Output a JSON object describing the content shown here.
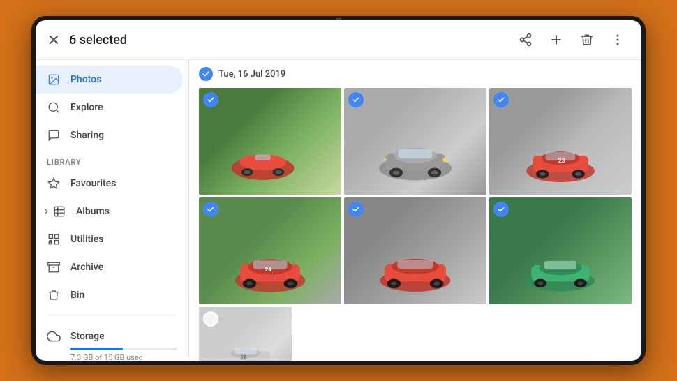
{
  "device": {
    "bg_color": "#D4711A"
  },
  "topbar": {
    "selected_count": "6 selected",
    "icons": {
      "close": "✕",
      "share": "share",
      "add": "+",
      "delete": "delete",
      "more": "⋮"
    }
  },
  "sidebar": {
    "nav_items": [
      {
        "id": "photos",
        "label": "Photos",
        "icon": "photos",
        "active": true
      },
      {
        "id": "explore",
        "label": "Explore",
        "icon": "explore",
        "active": false
      },
      {
        "id": "sharing",
        "label": "Sharing",
        "icon": "sharing",
        "active": false
      }
    ],
    "library_label": "LIBRARY",
    "library_items": [
      {
        "id": "favourites",
        "label": "Favourites",
        "icon": "star"
      },
      {
        "id": "albums",
        "label": "Albums",
        "icon": "albums",
        "has_chevron": true
      },
      {
        "id": "utilities",
        "label": "Utilities",
        "icon": "utilities"
      },
      {
        "id": "archive",
        "label": "Archive",
        "icon": "archive"
      },
      {
        "id": "bin",
        "label": "Bin",
        "icon": "bin"
      }
    ],
    "storage": {
      "label": "Storage",
      "used_gb": "7.3 GB",
      "total_gb": "15 GB",
      "usage_text": "7.3 GB of 15 GB used",
      "fill_percent": 49
    }
  },
  "photo_area": {
    "date_header": "Tue, 16 Jul 2019",
    "photos": [
      {
        "id": 1,
        "selected": true,
        "bg": "car-bg-1",
        "alt": "Red classic Ferrari roadster in field"
      },
      {
        "id": 2,
        "selected": true,
        "bg": "car-bg-2",
        "alt": "Grey classic Ferrari coupe"
      },
      {
        "id": 3,
        "selected": true,
        "bg": "car-bg-3",
        "alt": "Red Ferrari GTO number 23"
      },
      {
        "id": 4,
        "selected": true,
        "bg": "car-bg-4",
        "alt": "Red Ferrari racing car on track"
      },
      {
        "id": 5,
        "selected": true,
        "bg": "car-bg-5",
        "alt": "Red Ferrari GTO studio"
      },
      {
        "id": 6,
        "selected": true,
        "bg": "car-bg-6",
        "alt": "Teal vintage racing car in forest"
      },
      {
        "id": 7,
        "selected": false,
        "bg": "car-bg-7",
        "alt": "Silver vintage race car number 12"
      }
    ]
  }
}
